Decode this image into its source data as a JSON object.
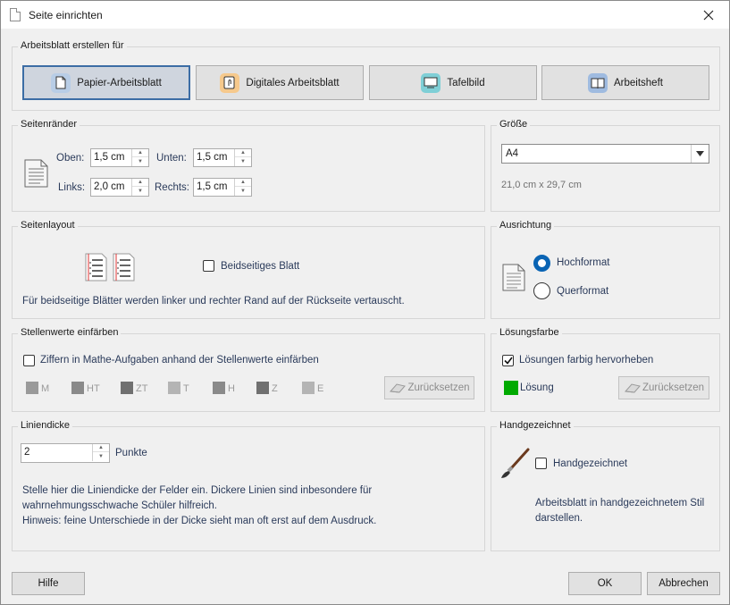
{
  "window": {
    "title": "Seite einrichten"
  },
  "create_for": {
    "legend": "Arbeitsblatt erstellen für",
    "modes": [
      {
        "label": "Papier-Arbeitsblatt",
        "icon": "paper-sheet-icon",
        "selected": true
      },
      {
        "label": "Digitales Arbeitsblatt",
        "icon": "touch-tablet-icon",
        "selected": false
      },
      {
        "label": "Tafelbild",
        "icon": "whiteboard-icon",
        "selected": false
      },
      {
        "label": "Arbeitsheft",
        "icon": "workbook-icon",
        "selected": false
      }
    ]
  },
  "margins": {
    "legend": "Seitenränder",
    "top_label": "Oben:",
    "top_value": "1,5 cm",
    "bottom_label": "Unten:",
    "bottom_value": "1,5 cm",
    "left_label": "Links:",
    "left_value": "2,0 cm",
    "right_label": "Rechts:",
    "right_value": "1,5 cm"
  },
  "size": {
    "legend": "Größe",
    "selected": "A4",
    "dimensions": "21,0 cm x 29,7 cm"
  },
  "layout": {
    "legend": "Seitenlayout",
    "double_sided_label": "Beidseitiges Blatt",
    "double_sided_checked": false,
    "note": "Für beidseitige Blätter werden linker und rechter Rand auf der Rückseite vertauscht."
  },
  "orientation": {
    "legend": "Ausrichtung",
    "portrait_label": "Hochformat",
    "landscape_label": "Querformat",
    "selected": "Hochformat"
  },
  "place_values": {
    "legend": "Stellenwerte einfärben",
    "checkbox_label": "Ziffern in Mathe-Aufgaben anhand der Stellenwerte einfärben",
    "checked": false,
    "items": [
      {
        "label": "M",
        "color": "#9a9a9a"
      },
      {
        "label": "HT",
        "color": "#8a8a8a"
      },
      {
        "label": "ZT",
        "color": "#707070"
      },
      {
        "label": "T",
        "color": "#b4b4b4"
      },
      {
        "label": "H",
        "color": "#8a8a8a"
      },
      {
        "label": "Z",
        "color": "#707070"
      },
      {
        "label": "E",
        "color": "#b4b4b4"
      }
    ],
    "reset_label": "Zurücksetzen"
  },
  "solution_color": {
    "legend": "Lösungsfarbe",
    "checkbox_label": "Lösungen farbig hervorheben",
    "checked": true,
    "swatch_label": "Lösung",
    "swatch_color": "#00aa00",
    "reset_label": "Zurücksetzen"
  },
  "line_width": {
    "legend": "Liniendicke",
    "value": "2",
    "unit": "Punkte",
    "note_line1": "Stelle hier die Liniendicke der Felder ein. Dickere Linien sind inbesondere für",
    "note_line2": "wahrnehmungsschwache Schüler hilfreich.",
    "note_line3": "Hinweis: feine Unterschiede in der Dicke sieht man oft erst auf dem Ausdruck."
  },
  "handdrawn": {
    "legend": "Handgezeichnet",
    "checkbox_label": "Handgezeichnet",
    "checked": false,
    "note_line1": "Arbeitsblatt in handgezeichnetem Stil",
    "note_line2": "darstellen."
  },
  "footer": {
    "help": "Hilfe",
    "ok": "OK",
    "cancel": "Abbrechen"
  }
}
